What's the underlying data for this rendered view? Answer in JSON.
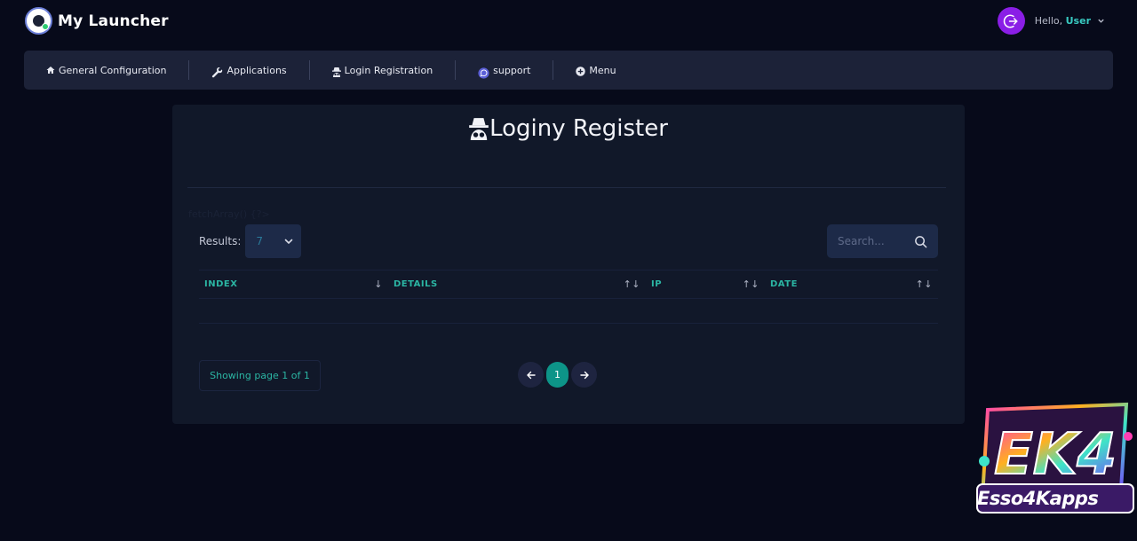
{
  "app": {
    "name": "My Launcher"
  },
  "user": {
    "greeting": "Hello,",
    "name": "User"
  },
  "nav": {
    "items": [
      {
        "label": "General Configuration",
        "icon": "home-icon"
      },
      {
        "label": "Applications",
        "icon": "wrench-icon"
      },
      {
        "label": "Login Registration",
        "icon": "incognito-icon"
      },
      {
        "label": "support",
        "icon": "whatsapp-icon"
      },
      {
        "label": "Menu",
        "icon": "plus-circle-icon"
      }
    ]
  },
  "page": {
    "title": "Loginy Register",
    "title_icon": "incognito-icon",
    "fetch_note": "fetchArray() {?>"
  },
  "table": {
    "results_label": "Results:",
    "results_value": "7",
    "search_placeholder": "Search...",
    "columns": [
      {
        "label": "INDEX",
        "sort": "↓"
      },
      {
        "label": "DETAILS",
        "sort": "↑↓"
      },
      {
        "label": "IP",
        "sort": "↑↓"
      },
      {
        "label": "DATE",
        "sort": "↑↓"
      }
    ],
    "rows": []
  },
  "pagination": {
    "showing": "Showing page 1 of 1",
    "current": "1"
  },
  "watermark": {
    "text": "Esso4Kapps",
    "logo_letters": "EK4"
  },
  "colors": {
    "background": "#070a1a",
    "navbar": "#1c2238",
    "card": "#111829",
    "accent": "#2bb5a3",
    "logout": "#8a1ee6",
    "active_page": "#0d9488"
  }
}
